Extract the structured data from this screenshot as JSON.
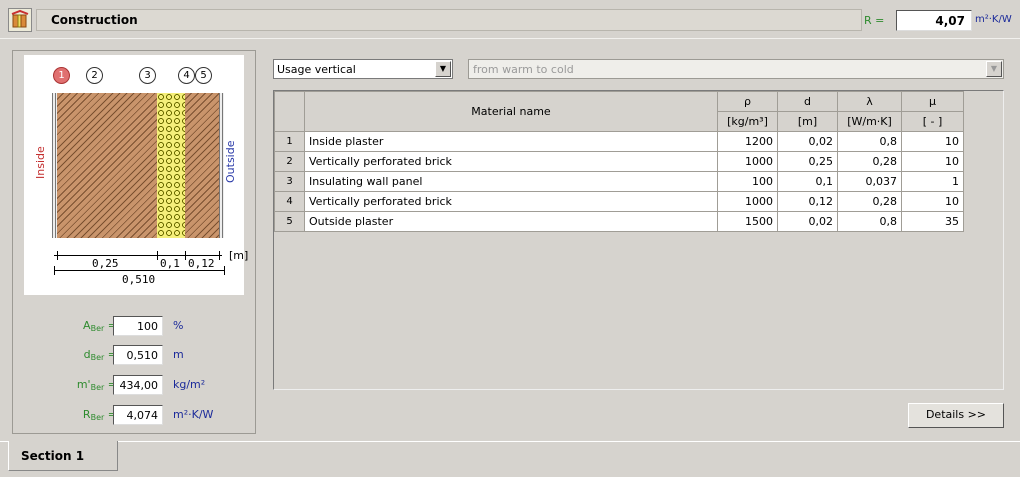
{
  "header": {
    "icon": "construction-icon",
    "title": "Construction",
    "r_label": "R =",
    "r_value": "4,07",
    "r_unit": "m²·K/W"
  },
  "diagram": {
    "layer_numbers": [
      "1",
      "2",
      "3",
      "4",
      "5"
    ],
    "inside_label": "Inside",
    "outside_label": "Outside",
    "dim_unit": "[m]",
    "dim_values": [
      "0,25",
      "0,1",
      "0,12"
    ],
    "dim_total": "0,510",
    "colors": {
      "brick": "#c9946b",
      "insulation": "#f5ef7a",
      "active_layer": "#e07070",
      "inside": "#c43030",
      "outside": "#2a3aa8"
    }
  },
  "params": [
    {
      "label_main": "A",
      "label_sub": "Ber",
      "suffix": " =",
      "value": "100",
      "unit": "%"
    },
    {
      "label_main": "d",
      "label_sub": "Ber",
      "suffix": " =",
      "value": "0,510",
      "unit": "m"
    },
    {
      "label_main": "m'",
      "label_sub": "Ber",
      "suffix": " =",
      "value": "434,00",
      "unit": "kg/m²"
    },
    {
      "label_main": "R",
      "label_sub": "Ber",
      "suffix": " =",
      "value": "4,074",
      "unit": "m²·K/W"
    }
  ],
  "controls": {
    "usage_selected": "Usage vertical",
    "direction_selected": "from warm to cold",
    "details_label": "Details >>"
  },
  "table": {
    "name_header": "Material name",
    "col_symbols": [
      "ρ",
      "d",
      "λ",
      "μ"
    ],
    "col_units": [
      "[kg/m³]",
      "[m]",
      "[W/m·K]",
      "[ - ]"
    ],
    "rows": [
      {
        "idx": "1",
        "name": "Inside plaster",
        "rho": "1200",
        "d": "0,02",
        "lambda": "0,8",
        "mu": "10"
      },
      {
        "idx": "2",
        "name": "Vertically perforated brick",
        "rho": "1000",
        "d": "0,25",
        "lambda": "0,28",
        "mu": "10"
      },
      {
        "idx": "3",
        "name": "Insulating wall panel",
        "rho": "100",
        "d": "0,1",
        "lambda": "0,037",
        "mu": "1"
      },
      {
        "idx": "4",
        "name": "Vertically perforated brick",
        "rho": "1000",
        "d": "0,12",
        "lambda": "0,28",
        "mu": "10"
      },
      {
        "idx": "5",
        "name": "Outside plaster",
        "rho": "1500",
        "d": "0,02",
        "lambda": "0,8",
        "mu": "35"
      }
    ]
  },
  "tabs": [
    {
      "label": "Section 1"
    }
  ]
}
